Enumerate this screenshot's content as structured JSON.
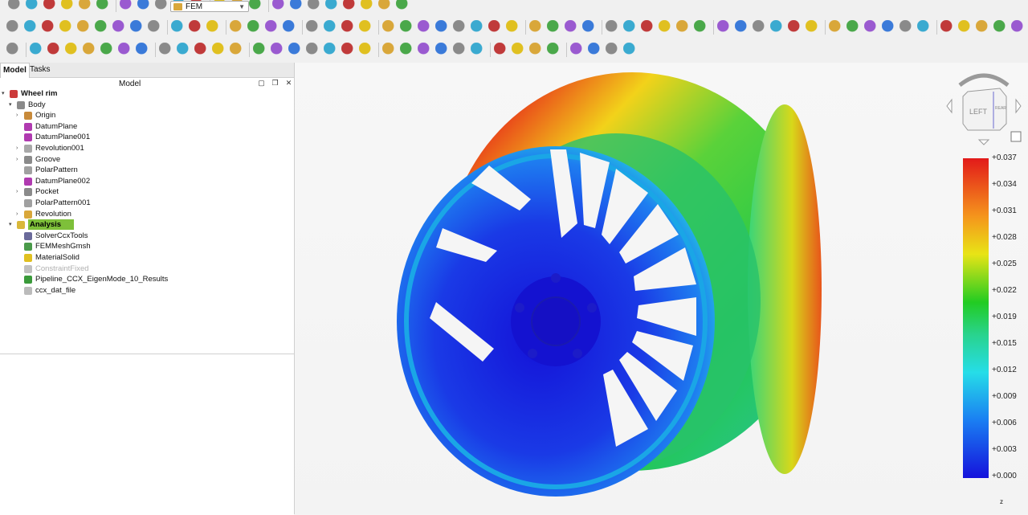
{
  "toolbar": {
    "workbench": "FEM"
  },
  "tabs": [
    "Model",
    "Tasks"
  ],
  "panel": {
    "title": "Model"
  },
  "tree": [
    {
      "label": "Wheel rim",
      "level": 0,
      "arrow": "▾",
      "icon": "document-icon",
      "color": "#cc3a3a",
      "bold": true
    },
    {
      "label": "Body",
      "level": 1,
      "arrow": "▾",
      "icon": "body-icon",
      "color": "#8a8a8a"
    },
    {
      "label": "Origin",
      "level": 2,
      "arrow": "›",
      "icon": "origin-icon",
      "color": "#c88a3a"
    },
    {
      "label": "DatumPlane",
      "level": 2,
      "arrow": "",
      "icon": "datum-plane-icon",
      "color": "#b03ab0"
    },
    {
      "label": "DatumPlane001",
      "level": 2,
      "arrow": "",
      "icon": "datum-plane-icon",
      "color": "#b03ab0"
    },
    {
      "label": "Revolution001",
      "level": 2,
      "arrow": "›",
      "icon": "revolution-icon",
      "color": "#a8a8a8"
    },
    {
      "label": "Groove",
      "level": 2,
      "arrow": "›",
      "icon": "groove-icon",
      "color": "#8a8a8a"
    },
    {
      "label": "PolarPattern",
      "level": 2,
      "arrow": "",
      "icon": "polar-pattern-icon",
      "color": "#a0a0a0"
    },
    {
      "label": "DatumPlane002",
      "level": 2,
      "arrow": "",
      "icon": "datum-plane-icon",
      "color": "#b03ab0"
    },
    {
      "label": "Pocket",
      "level": 2,
      "arrow": "›",
      "icon": "pocket-icon",
      "color": "#8a8a8a"
    },
    {
      "label": "PolarPattern001",
      "level": 2,
      "arrow": "",
      "icon": "polar-pattern-icon",
      "color": "#a0a0a0"
    },
    {
      "label": "Revolution",
      "level": 2,
      "arrow": "›",
      "icon": "revolution-icon",
      "color": "#d9a73a"
    },
    {
      "label": "Analysis",
      "level": 1,
      "arrow": "▾",
      "icon": "analysis-icon",
      "color": "#d9b83a",
      "selected": true
    },
    {
      "label": "SolverCcxTools",
      "level": 2,
      "arrow": "",
      "icon": "solver-icon",
      "color": "#6a6a9a"
    },
    {
      "label": "FEMMeshGmsh",
      "level": 2,
      "arrow": "",
      "icon": "mesh-icon",
      "color": "#4a9a4a"
    },
    {
      "label": "MaterialSolid",
      "level": 2,
      "arrow": "",
      "icon": "material-icon",
      "color": "#e0c020"
    },
    {
      "label": "ConstraintFixed",
      "level": 2,
      "arrow": "",
      "icon": "constraint-icon",
      "color": "#c0c0c0",
      "dim": true
    },
    {
      "label": "Pipeline_CCX_EigenMode_10_Results",
      "level": 2,
      "arrow": "",
      "icon": "pipeline-icon",
      "color": "#3a9a3a"
    },
    {
      "label": "ccx_dat_file",
      "level": 2,
      "arrow": "",
      "icon": "text-file-icon",
      "color": "#bbbbbb"
    }
  ],
  "legend": {
    "labels": [
      "+0.037",
      "+0.034",
      "+0.031",
      "+0.028",
      "+0.025",
      "+0.022",
      "+0.019",
      "+0.015",
      "+0.012",
      "+0.009",
      "+0.006",
      "+0.003",
      "+0.000"
    ]
  },
  "navcube": {
    "face": "LEFT",
    "side": "REAR"
  },
  "axis": {
    "label": "z"
  }
}
